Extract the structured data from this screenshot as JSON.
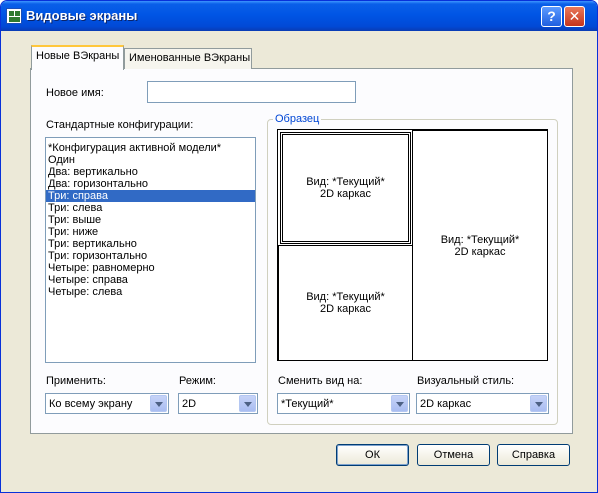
{
  "window": {
    "title": "Видовые экраны",
    "help_glyph": "?",
    "close_glyph": "✕"
  },
  "tabs": [
    {
      "label": "Новые ВЭкраны",
      "active": true
    },
    {
      "label": "Именованные ВЭкраны",
      "active": false
    }
  ],
  "new_name": {
    "label": "Новое имя:",
    "value": ""
  },
  "configs": {
    "label": "Стандартные конфигурации:",
    "selected_index": 4,
    "items": [
      "*Конфигурация активной модели*",
      "Один",
      "Два: вертикально",
      "Два: горизонтально",
      "Три: справа",
      "Три: слева",
      "Три: выше",
      "Три: ниже",
      "Три: вертикально",
      "Три: горизонтально",
      "Четыре: равномерно",
      "Четыре: справа",
      "Четыре: слева"
    ]
  },
  "preview": {
    "group_title": "Образец",
    "viewports": [
      {
        "line1": "Вид: *Текущий*",
        "line2": "2D каркас"
      },
      {
        "line1": "Вид: *Текущий*",
        "line2": "2D каркас"
      },
      {
        "line1": "Вид: *Текущий*",
        "line2": "2D каркас"
      }
    ]
  },
  "apply": {
    "label": "Применить:",
    "value": "Ко всему экрану"
  },
  "mode": {
    "label": "Режим:",
    "value": "2D"
  },
  "change_view": {
    "label": "Сменить вид на:",
    "value": "*Текущий*"
  },
  "visual_style": {
    "label": "Визуальный стиль:",
    "value": "2D каркас"
  },
  "buttons": {
    "ok": "ОК",
    "cancel": "Отмена",
    "help": "Справка"
  }
}
